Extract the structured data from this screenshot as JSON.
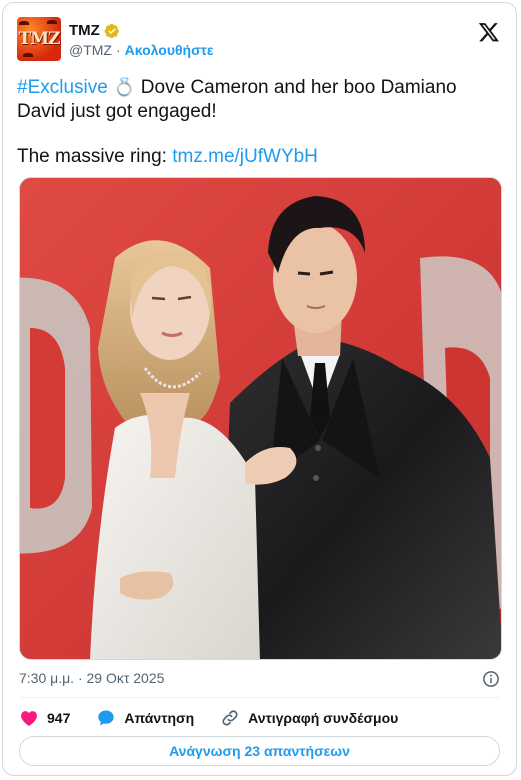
{
  "account": {
    "name": "TMZ",
    "handle": "@TMZ",
    "separator": "·",
    "follow_label": "Ακολουθήστε",
    "avatar_text": "TMZ"
  },
  "tweet": {
    "hashtag": "#Exclusive",
    "text_rest": " Dove Cameron and her boo Damiano David just got engaged!",
    "line2_prefix": "The massive ring: ",
    "link": "tmz.me/jUfWYbH"
  },
  "meta": {
    "timestamp": "7:30 μ.μ. · 29 Οκτ 2025"
  },
  "actions": {
    "like_count": "947",
    "reply_label": "Απάντηση",
    "copy_link_label": "Αντιγραφή συνδέσμου"
  },
  "read_replies_label": "Ανάγνωση 23 απαντήσεων",
  "colors": {
    "accent": "#1d9bf0",
    "like": "#f91880",
    "verified": "#e2b719",
    "text": "#0f1419",
    "muted": "#536471",
    "photo_background": "#d43a36"
  }
}
